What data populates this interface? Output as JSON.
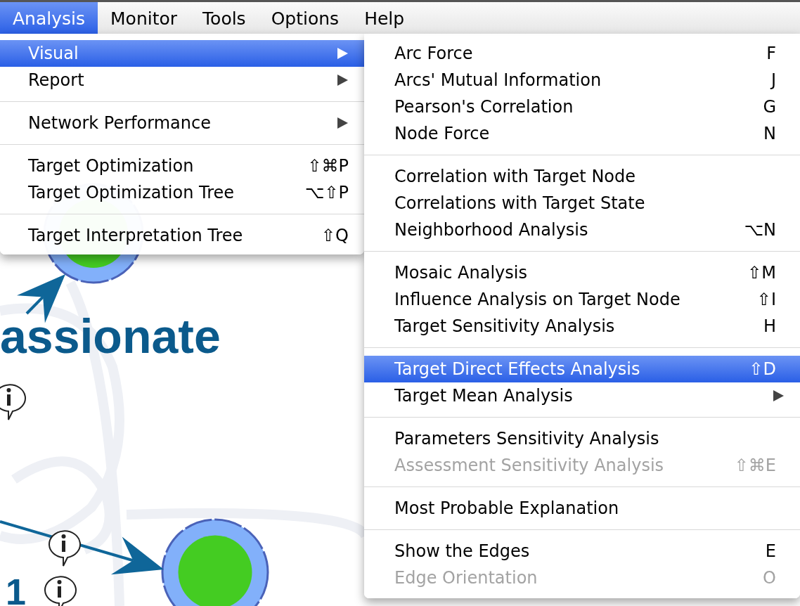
{
  "menubar": [
    {
      "label": "Analysis",
      "selected": true
    },
    {
      "label": "Monitor",
      "selected": false
    },
    {
      "label": "Tools",
      "selected": false
    },
    {
      "label": "Options",
      "selected": false
    },
    {
      "label": "Help",
      "selected": false
    }
  ],
  "canvas": {
    "heading": "assionate",
    "node_label": "1"
  },
  "analysis_menu": {
    "groups": [
      [
        {
          "label": "Visual",
          "has_submenu": true,
          "selected": true
        },
        {
          "label": "Report",
          "has_submenu": true,
          "selected": false
        }
      ],
      [
        {
          "label": "Network Performance",
          "has_submenu": true,
          "selected": false
        }
      ],
      [
        {
          "label": "Target Optimization",
          "shortcut": "⇧⌘P",
          "has_submenu": false,
          "selected": false
        },
        {
          "label": "Target Optimization Tree",
          "shortcut": "⌥⇧P",
          "has_submenu": false,
          "selected": false
        }
      ],
      [
        {
          "label": "Target Interpretation Tree",
          "shortcut": "⇧Q",
          "has_submenu": false,
          "selected": false
        }
      ]
    ]
  },
  "visual_submenu": {
    "groups": [
      [
        {
          "label": "Arc Force",
          "shortcut": "F",
          "has_submenu": false,
          "selected": false,
          "disabled": false
        },
        {
          "label": "Arcs' Mutual Information",
          "shortcut": "J",
          "has_submenu": false,
          "selected": false,
          "disabled": false
        },
        {
          "label": "Pearson's Correlation",
          "shortcut": "G",
          "has_submenu": false,
          "selected": false,
          "disabled": false
        },
        {
          "label": "Node Force",
          "shortcut": "N",
          "has_submenu": false,
          "selected": false,
          "disabled": false
        }
      ],
      [
        {
          "label": "Correlation with Target Node",
          "has_submenu": false,
          "selected": false,
          "disabled": false
        },
        {
          "label": "Correlations with Target State",
          "has_submenu": false,
          "selected": false,
          "disabled": false
        },
        {
          "label": "Neighborhood Analysis",
          "shortcut": "⌥N",
          "has_submenu": false,
          "selected": false,
          "disabled": false
        }
      ],
      [
        {
          "label": "Mosaic Analysis",
          "shortcut": "⇧M",
          "has_submenu": false,
          "selected": false,
          "disabled": false
        },
        {
          "label": "Influence Analysis on Target Node",
          "shortcut": "⇧I",
          "has_submenu": false,
          "selected": false,
          "disabled": false
        },
        {
          "label": "Target Sensitivity Analysis",
          "shortcut": "H",
          "has_submenu": false,
          "selected": false,
          "disabled": false
        }
      ],
      [
        {
          "label": "Target Direct Effects Analysis",
          "shortcut": "⇧D",
          "has_submenu": false,
          "selected": true,
          "disabled": false
        },
        {
          "label": "Target Mean Analysis",
          "has_submenu": true,
          "selected": false,
          "disabled": false
        }
      ],
      [
        {
          "label": "Parameters Sensitivity Analysis",
          "has_submenu": false,
          "selected": false,
          "disabled": false
        },
        {
          "label": "Assessment Sensitivity Analysis",
          "shortcut": "⇧⌘E",
          "has_submenu": false,
          "selected": false,
          "disabled": true
        }
      ],
      [
        {
          "label": "Most Probable Explanation",
          "has_submenu": false,
          "selected": false,
          "disabled": false
        }
      ],
      [
        {
          "label": "Show the Edges",
          "shortcut": "E",
          "has_submenu": false,
          "selected": false,
          "disabled": false
        },
        {
          "label": "Edge Orientation",
          "shortcut": "O",
          "has_submenu": false,
          "selected": false,
          "disabled": true
        }
      ]
    ]
  }
}
